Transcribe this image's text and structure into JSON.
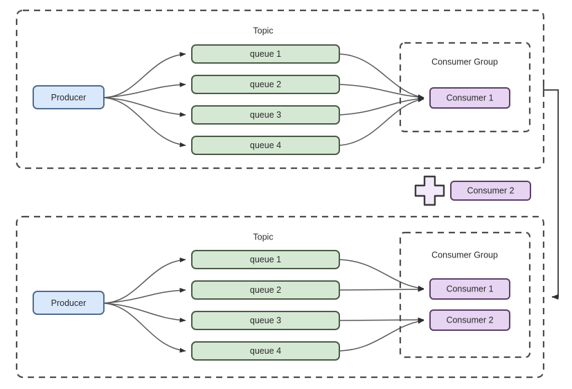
{
  "diagram": {
    "title": "Kafka/RocketMQ topic partition rebalancing across consumer group",
    "colors": {
      "producer_fill": "#dae8fc",
      "producer_stroke": "#4f6d8e",
      "queue_fill": "#d5e8d4",
      "queue_stroke": "#4b5c46",
      "consumer_fill": "#e6d4f2",
      "consumer_stroke": "#5c4066",
      "container_stroke": "#4d4d4d",
      "edge_stroke": "#59595c",
      "text": "#2b2b2b",
      "background": "#ffffff"
    },
    "scenarios": [
      {
        "id": "before",
        "topic_label": "Topic",
        "consumer_group_label": "Consumer Group",
        "producer_label": "Producer",
        "queues": [
          {
            "label": "queue 1"
          },
          {
            "label": "queue 2"
          },
          {
            "label": "queue 3"
          },
          {
            "label": "queue 4"
          }
        ],
        "consumers": [
          {
            "label": "Consumer 1"
          }
        ],
        "assignments": [
          {
            "queue": "queue 1",
            "consumer": "Consumer 1"
          },
          {
            "queue": "queue 2",
            "consumer": "Consumer 1"
          },
          {
            "queue": "queue 3",
            "consumer": "Consumer 1"
          },
          {
            "queue": "queue 4",
            "consumer": "Consumer 1"
          }
        ]
      },
      {
        "id": "after",
        "topic_label": "Topic",
        "consumer_group_label": "Consumer Group",
        "producer_label": "Producer",
        "queues": [
          {
            "label": "queue 1"
          },
          {
            "label": "queue 2"
          },
          {
            "label": "queue 3"
          },
          {
            "label": "queue 4"
          }
        ],
        "consumers": [
          {
            "label": "Consumer 1"
          },
          {
            "label": "Consumer 2"
          }
        ],
        "assignments": [
          {
            "queue": "queue 1",
            "consumer": "Consumer 1"
          },
          {
            "queue": "queue 2",
            "consumer": "Consumer 1"
          },
          {
            "queue": "queue 3",
            "consumer": "Consumer 2"
          },
          {
            "queue": "queue 4",
            "consumer": "Consumer 2"
          }
        ]
      }
    ],
    "transition": {
      "plus_icon": "plus-icon",
      "added_consumer_label": "Consumer 2"
    }
  }
}
